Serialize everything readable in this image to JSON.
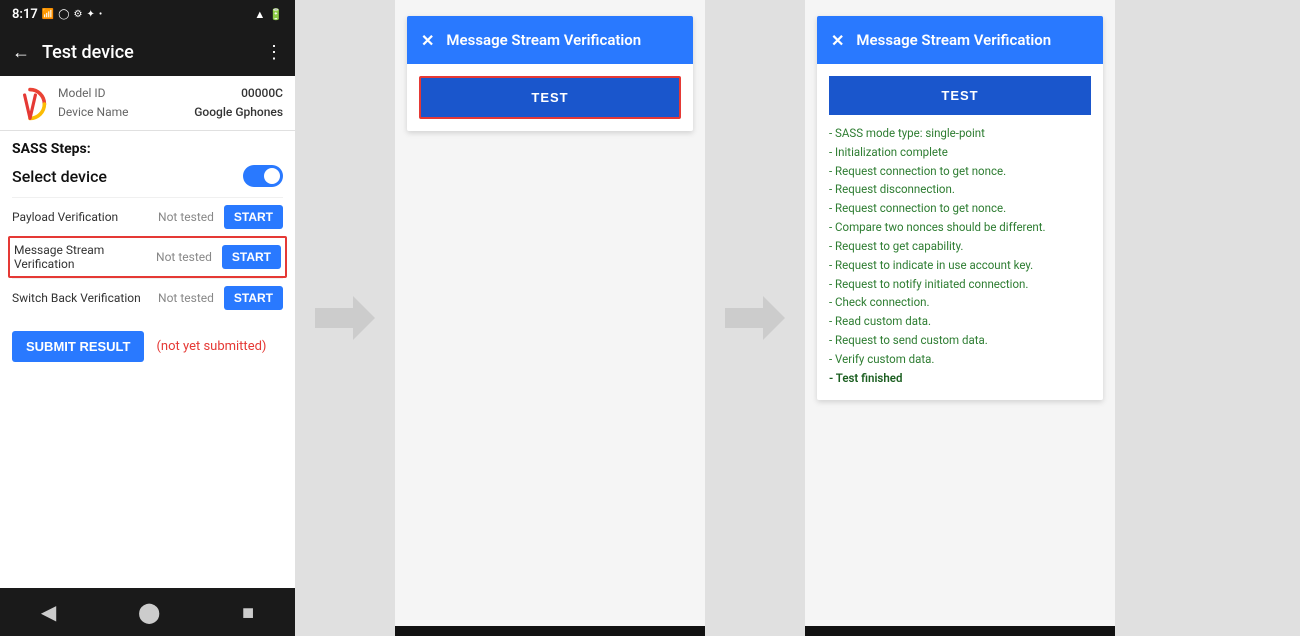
{
  "phone": {
    "status_time": "8:17",
    "app_title": "Test device",
    "device": {
      "model_id_label": "Model ID",
      "model_id_value": "00000C",
      "device_name_label": "Device Name",
      "device_name_value": "Google Gphones"
    },
    "sass_title": "SASS Steps:",
    "select_device_label": "Select device",
    "steps": [
      {
        "label": "Payload Verification",
        "status": "Not tested",
        "btn": "START"
      },
      {
        "label": "Message Stream\nVerification",
        "status": "Not tested",
        "btn": "START",
        "highlighted": true
      },
      {
        "label": "Switch Back Verification",
        "status": "Not tested",
        "btn": "START"
      }
    ],
    "submit_btn": "SUBMIT RESULT",
    "not_submitted": "(not yet submitted)"
  },
  "dialog1": {
    "title": "Message Stream Verification",
    "close_icon": "✕",
    "test_btn": "TEST"
  },
  "dialog2": {
    "title": "Message Stream Verification",
    "close_icon": "✕",
    "test_btn": "TEST",
    "results": [
      "- SASS mode type: single-point",
      "- Initialization complete",
      "- Request connection to get nonce.",
      "- Request disconnection.",
      "- Request connection to get nonce.",
      "- Compare two nonces should be different.",
      "- Request to get capability.",
      "- Request to indicate in use account key.",
      "- Request to notify initiated connection.",
      "- Check connection.",
      "- Read custom data.",
      "- Request to send custom data.",
      "- Verify custom data.",
      "- Test finished"
    ]
  }
}
